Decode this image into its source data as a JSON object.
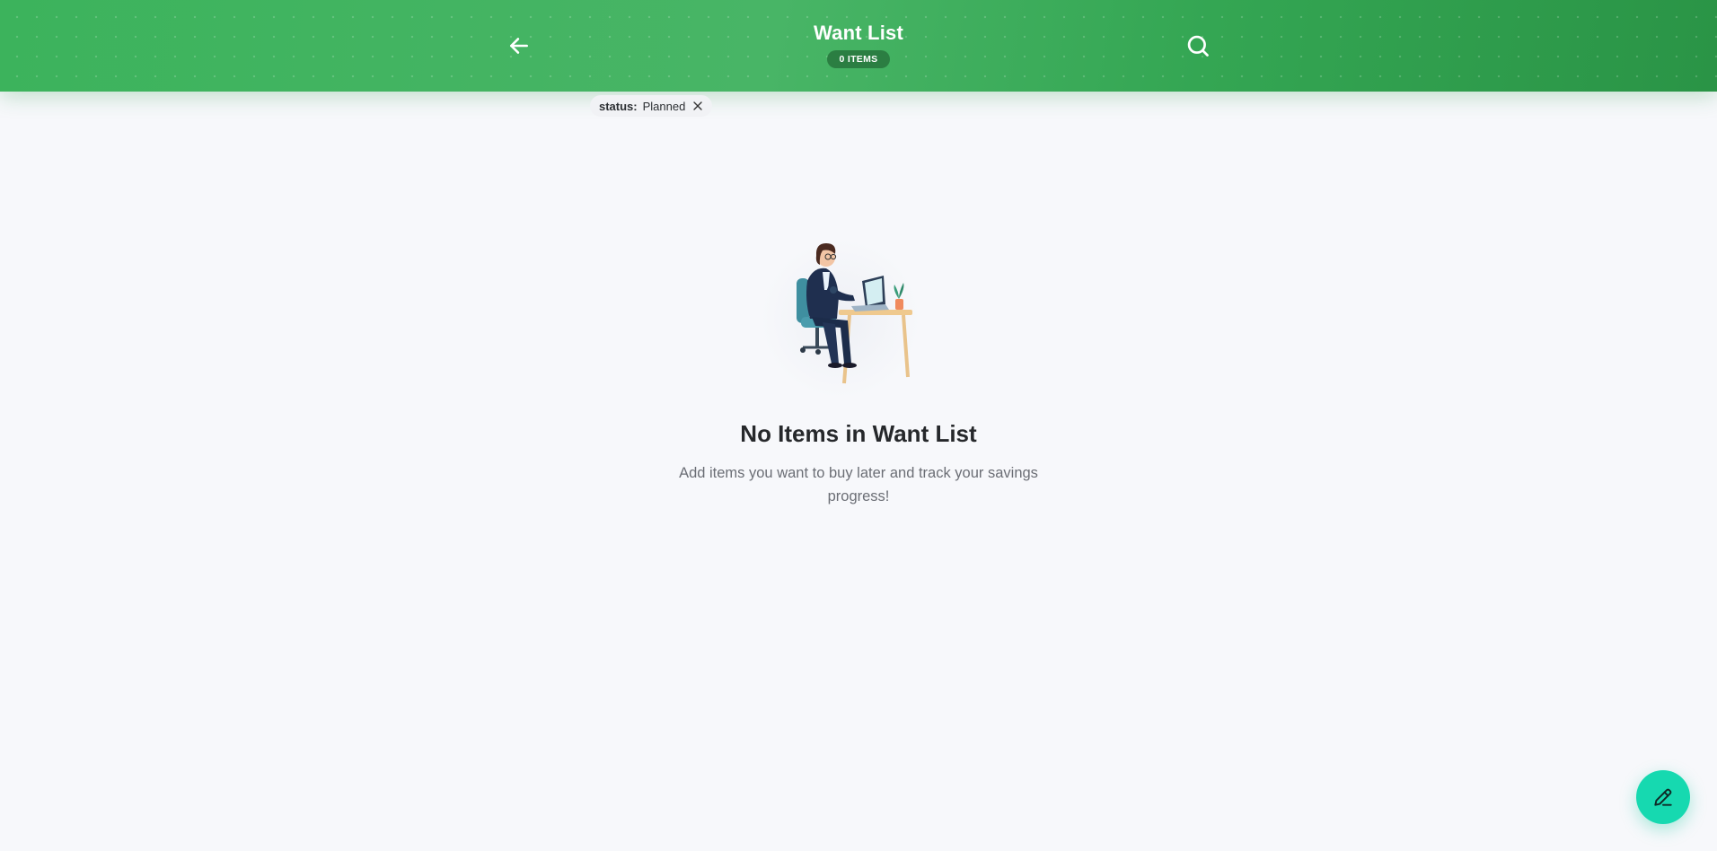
{
  "header": {
    "title": "Want List",
    "count_badge": "0 ITEMS",
    "back_icon": "arrow-left-icon",
    "search_icon": "search-icon"
  },
  "filter_chip": {
    "key": "status:",
    "value": "Planned",
    "close_icon": "close-icon"
  },
  "empty_state": {
    "illustration": "woman-working-at-laptop-illustration",
    "title": "No Items in Want List",
    "description": "Add items you want to buy later and track your savings progress!"
  },
  "fab": {
    "icon": "pencil-icon"
  },
  "colors": {
    "header_green": "#3cb35c",
    "badge_green": "#2b7e42",
    "fab_teal": "#16d9b0",
    "background": "#f7f8fb"
  }
}
